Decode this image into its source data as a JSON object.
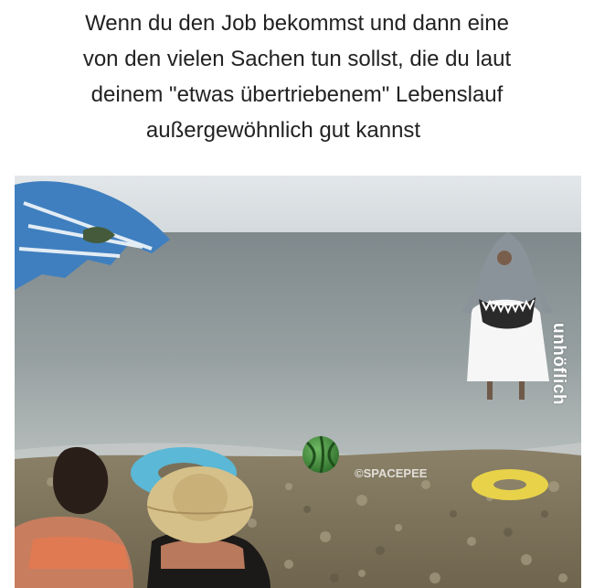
{
  "caption": {
    "lines": [
      "Wenn du den Job bekommst und dann eine",
      "von den vielen Sachen tun sollst, die du laut",
      "deinem \"etwas übertriebenem\" Lebenslauf",
      "außergewöhnlich gut kannst"
    ]
  },
  "watermarks": {
    "brand": "unhöflich",
    "credit": "©SPACEPEE"
  },
  "colors": {
    "sky": "#dfe4e7",
    "sea": "#9aa3a4",
    "shore_water": "#b9c0c0",
    "pebbles": "#8f8468",
    "umbrella": "#3f7fbf",
    "melon": "#3f8f3a",
    "ring_blue": "#5bb8d6",
    "ring_yellow": "#e7d24a"
  }
}
